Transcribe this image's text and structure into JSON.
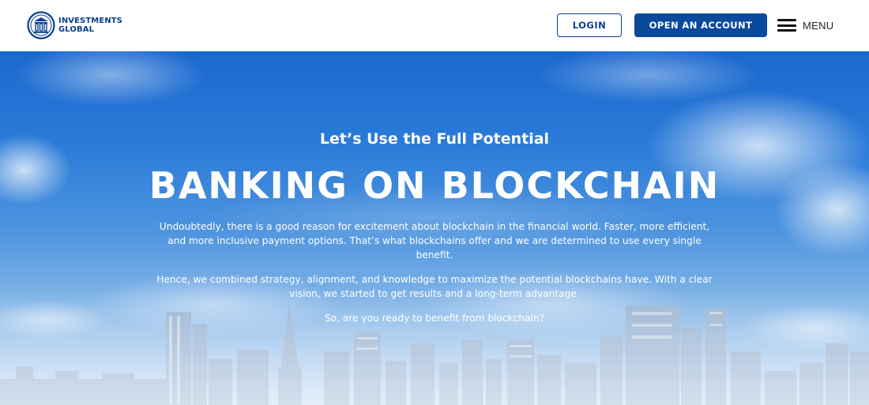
{
  "header": {
    "logo": {
      "line1": "INVESTMENTS",
      "line2": "GLOBAL",
      "icon": "bank-columns-icon"
    },
    "login_label": "LOGIN",
    "open_account_label": "OPEN AN ACCOUNT",
    "menu_label": "MENU",
    "menu_icon": "hamburger-icon"
  },
  "hero": {
    "kicker": "Let’s Use the Full Potential",
    "headline": "BANKING ON BLOCKCHAIN",
    "paragraphs": [
      "Undoubtedly, there is a good reason for excitement about blockchain in the financial world. Faster, more efficient, and more inclusive payment options. That’s what blockchains offer and we are determined to use every single benefit.",
      "Hence, we combined strategy, alignment, and knowledge to maximize the potential blockchains have. With a clear vision, we started to get results and a long-term advantage.",
      "So, are you ready to benefit from blockchain?"
    ],
    "background": "sky-and-city-skyline-image"
  },
  "colors": {
    "brand_blue": "#0a4a9c",
    "brand_dark_blue": "#0a3f8f",
    "header_bg": "#ffffff",
    "hero_text": "#ffffff"
  }
}
